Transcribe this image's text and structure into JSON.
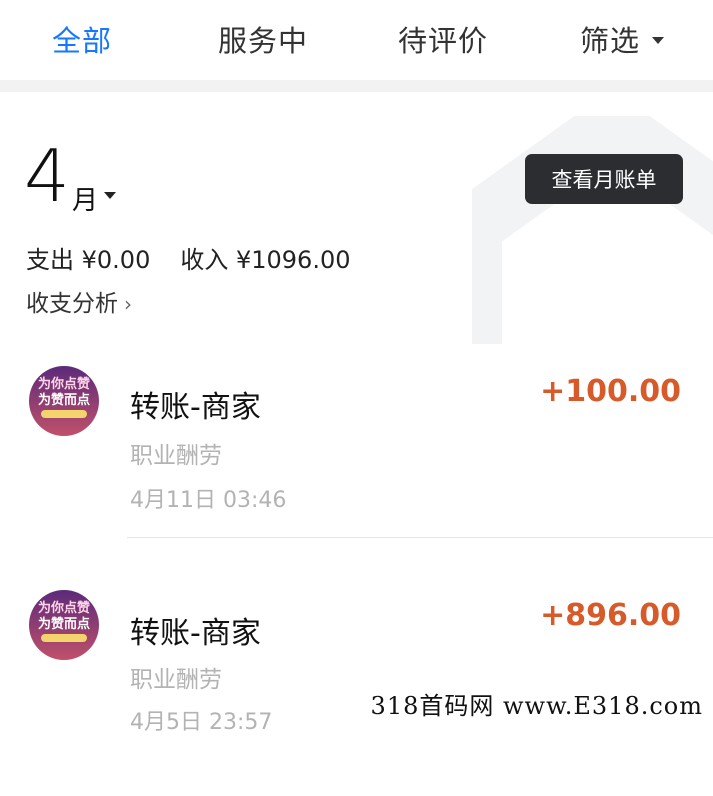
{
  "tabs": [
    {
      "label": "全部",
      "active": true
    },
    {
      "label": "服务中",
      "active": false
    },
    {
      "label": "待评价",
      "active": false
    },
    {
      "label": "筛选",
      "active": false
    }
  ],
  "summary": {
    "month_number": "4",
    "month_unit": "月",
    "bill_button": "查看月账单",
    "expense": "支出 ¥0.00",
    "income": "收入 ¥1096.00",
    "analysis": "收支分析",
    "analysis_chevron": "›"
  },
  "transactions": [
    {
      "title": "转账-商家",
      "category": "职业酬劳",
      "time": "4月11日 03:46",
      "amount": "+100.00"
    },
    {
      "title": "转账-商家",
      "category": "职业酬劳",
      "time": "4月5日 23:57",
      "amount": "+896.00"
    }
  ],
  "avatar_text": {
    "line1": "为你点赞",
    "line2": "为赞而点"
  },
  "watermark": "318首码网  www.E318.com",
  "colors": {
    "accent": "#1677ff",
    "amount": "#d75b2a",
    "button_bg": "#2b2d30",
    "muted": "#b3b3b3"
  }
}
